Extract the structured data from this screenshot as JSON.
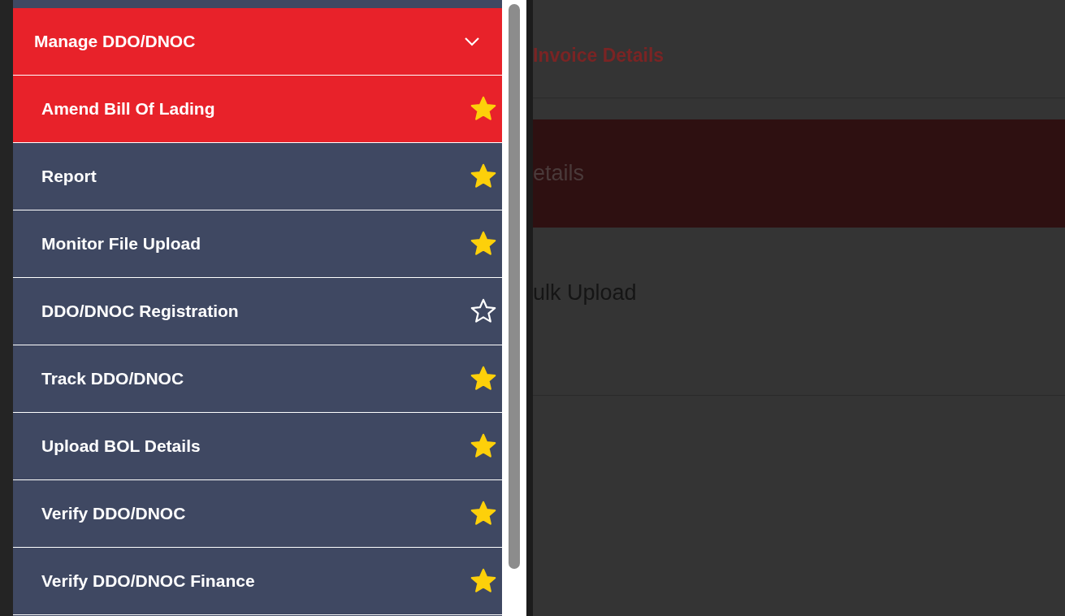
{
  "menu": {
    "header": {
      "label": "Manage DDO/DNOC",
      "expanded": true
    },
    "items": [
      {
        "label": "Amend Bill Of Lading",
        "selected": true,
        "favorite": true
      },
      {
        "label": "Report",
        "selected": false,
        "favorite": true
      },
      {
        "label": "Monitor File Upload",
        "selected": false,
        "favorite": true
      },
      {
        "label": "DDO/DNOC Registration",
        "selected": false,
        "favorite": false
      },
      {
        "label": "Track DDO/DNOC",
        "selected": false,
        "favorite": true
      },
      {
        "label": "Upload BOL Details",
        "selected": false,
        "favorite": true
      },
      {
        "label": "Verify DDO/DNOC",
        "selected": false,
        "favorite": true
      },
      {
        "label": "Verify DDO/DNOC Finance",
        "selected": false,
        "favorite": true
      }
    ]
  },
  "background_page": {
    "items": [
      {
        "label": "Invoice Details",
        "kind": "heading"
      },
      {
        "label": "etails",
        "kind": "highlighted"
      },
      {
        "label": "ulk Upload",
        "kind": "plain"
      }
    ]
  }
}
